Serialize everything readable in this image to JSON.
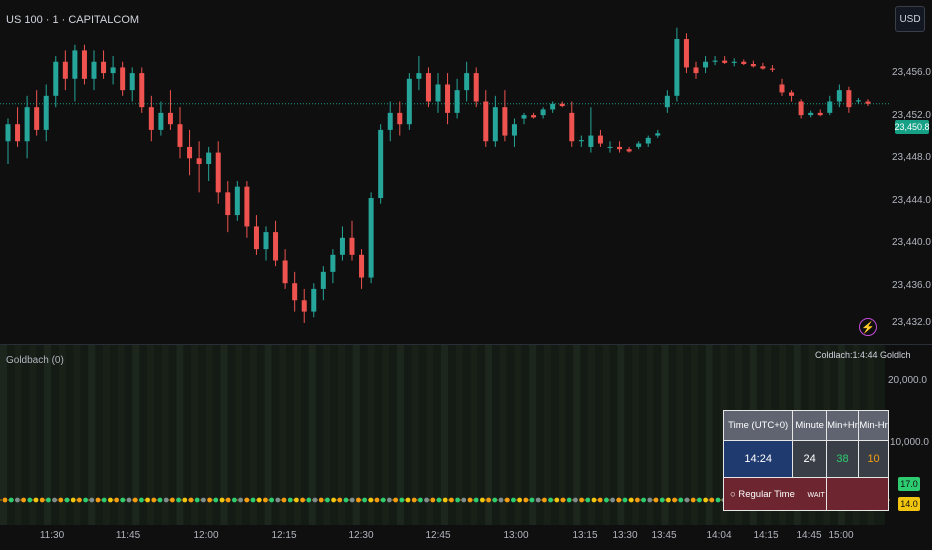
{
  "header": {
    "symbol": "US 100 · 1 · CAPITALCOM",
    "currency": "USD"
  },
  "price_axis": {
    "labels": [
      "23,456.0",
      "23,452.0",
      "23,448.0",
      "23,444.0",
      "23,440.0",
      "23,436.0",
      "23,432.0"
    ],
    "current_price": "23,450.8"
  },
  "indicator": {
    "title": "Goldbach (0)",
    "overlap_text": "Coldlach:1:4:44 Goldlch",
    "axis_labels": [
      "20,000.0",
      "10,000.0"
    ],
    "tag_green": "17.0",
    "tag_yellow": "14.0"
  },
  "time_axis": [
    "11:30",
    "11:45",
    "12:00",
    "12:15",
    "12:30",
    "12:45",
    "13:00",
    "13:15",
    "13:30",
    "13:45",
    "14:04",
    "14:15",
    "14:45",
    "15:00"
  ],
  "table": {
    "headers": [
      "Time (UTC+0)",
      "Minute",
      "Min+Hr",
      "Min-Hr"
    ],
    "time": "14:24",
    "minute": "24",
    "min_plus_hr": "38",
    "min_minus_hr": "10",
    "mode": "○ Regular Time",
    "signal": "WAIT"
  },
  "colors": {
    "up": "#26a69a",
    "down": "#ef5350",
    "background": "#0f0f0f",
    "price_line": "#16a085",
    "grid": "#1e222d"
  },
  "chart_data": {
    "type": "candlestick",
    "ylim": [
      23430,
      23458
    ],
    "candles": [
      {
        "o": 23447.5,
        "h": 23449.5,
        "l": 23445.5,
        "c": 23449.0
      },
      {
        "o": 23449.0,
        "h": 23450.5,
        "l": 23447.0,
        "c": 23447.5
      },
      {
        "o": 23447.5,
        "h": 23451.5,
        "l": 23446.0,
        "c": 23450.5
      },
      {
        "o": 23450.5,
        "h": 23452.0,
        "l": 23448.0,
        "c": 23448.5
      },
      {
        "o": 23448.5,
        "h": 23452.5,
        "l": 23447.5,
        "c": 23451.5
      },
      {
        "o": 23451.5,
        "h": 23455.0,
        "l": 23450.5,
        "c": 23454.5
      },
      {
        "o": 23454.5,
        "h": 23455.5,
        "l": 23452.0,
        "c": 23453.0
      },
      {
        "o": 23453.0,
        "h": 23456.0,
        "l": 23451.0,
        "c": 23455.5
      },
      {
        "o": 23455.5,
        "h": 23456.0,
        "l": 23452.5,
        "c": 23453.0
      },
      {
        "o": 23453.0,
        "h": 23455.5,
        "l": 23452.0,
        "c": 23454.5
      },
      {
        "o": 23454.5,
        "h": 23455.5,
        "l": 23453.0,
        "c": 23453.5
      },
      {
        "o": 23453.5,
        "h": 23455.0,
        "l": 23452.5,
        "c": 23454.0
      },
      {
        "o": 23454.0,
        "h": 23454.5,
        "l": 23451.5,
        "c": 23452.0
      },
      {
        "o": 23452.0,
        "h": 23454.0,
        "l": 23451.0,
        "c": 23453.5
      },
      {
        "o": 23453.5,
        "h": 23454.0,
        "l": 23450.0,
        "c": 23450.5
      },
      {
        "o": 23450.5,
        "h": 23451.5,
        "l": 23447.5,
        "c": 23448.5
      },
      {
        "o": 23448.5,
        "h": 23451.0,
        "l": 23448.0,
        "c": 23450.0
      },
      {
        "o": 23450.0,
        "h": 23452.0,
        "l": 23448.5,
        "c": 23449.0
      },
      {
        "o": 23449.0,
        "h": 23450.5,
        "l": 23446.0,
        "c": 23447.0
      },
      {
        "o": 23447.0,
        "h": 23448.5,
        "l": 23444.5,
        "c": 23446.0
      },
      {
        "o": 23446.0,
        "h": 23447.5,
        "l": 23443.0,
        "c": 23445.5
      },
      {
        "o": 23445.5,
        "h": 23447.0,
        "l": 23444.0,
        "c": 23446.5
      },
      {
        "o": 23446.5,
        "h": 23447.5,
        "l": 23442.0,
        "c": 23443.0
      },
      {
        "o": 23443.0,
        "h": 23444.0,
        "l": 23439.5,
        "c": 23441.0
      },
      {
        "o": 23441.0,
        "h": 23444.0,
        "l": 23440.5,
        "c": 23443.5
      },
      {
        "o": 23443.5,
        "h": 23444.0,
        "l": 23439.0,
        "c": 23440.0
      },
      {
        "o": 23440.0,
        "h": 23441.0,
        "l": 23437.5,
        "c": 23438.0
      },
      {
        "o": 23438.0,
        "h": 23440.0,
        "l": 23437.0,
        "c": 23439.5
      },
      {
        "o": 23439.5,
        "h": 23440.5,
        "l": 23436.5,
        "c": 23437.0
      },
      {
        "o": 23437.0,
        "h": 23438.0,
        "l": 23434.5,
        "c": 23435.0
      },
      {
        "o": 23435.0,
        "h": 23436.0,
        "l": 23432.5,
        "c": 23433.5
      },
      {
        "o": 23433.5,
        "h": 23434.5,
        "l": 23431.5,
        "c": 23432.5
      },
      {
        "o": 23432.5,
        "h": 23435.0,
        "l": 23432.0,
        "c": 23434.5
      },
      {
        "o": 23434.5,
        "h": 23436.5,
        "l": 23433.5,
        "c": 23436.0
      },
      {
        "o": 23436.0,
        "h": 23438.0,
        "l": 23435.0,
        "c": 23437.5
      },
      {
        "o": 23437.5,
        "h": 23440.0,
        "l": 23437.0,
        "c": 23439.0
      },
      {
        "o": 23439.0,
        "h": 23440.5,
        "l": 23437.0,
        "c": 23437.5
      },
      {
        "o": 23437.5,
        "h": 23438.0,
        "l": 23434.5,
        "c": 23435.5
      },
      {
        "o": 23435.5,
        "h": 23443.0,
        "l": 23435.0,
        "c": 23442.5
      },
      {
        "o": 23442.5,
        "h": 23449.0,
        "l": 23442.0,
        "c": 23448.5
      },
      {
        "o": 23448.5,
        "h": 23451.0,
        "l": 23447.5,
        "c": 23450.0
      },
      {
        "o": 23450.0,
        "h": 23451.0,
        "l": 23448.0,
        "c": 23449.0
      },
      {
        "o": 23449.0,
        "h": 23453.5,
        "l": 23448.5,
        "c": 23453.0
      },
      {
        "o": 23453.0,
        "h": 23455.0,
        "l": 23452.0,
        "c": 23453.5
      },
      {
        "o": 23453.5,
        "h": 23454.0,
        "l": 23450.5,
        "c": 23451.0
      },
      {
        "o": 23451.0,
        "h": 23453.5,
        "l": 23450.0,
        "c": 23452.5
      },
      {
        "o": 23452.5,
        "h": 23453.5,
        "l": 23449.0,
        "c": 23450.0
      },
      {
        "o": 23450.0,
        "h": 23453.0,
        "l": 23449.5,
        "c": 23452.0
      },
      {
        "o": 23452.0,
        "h": 23454.5,
        "l": 23451.0,
        "c": 23453.5
      },
      {
        "o": 23453.5,
        "h": 23454.0,
        "l": 23450.5,
        "c": 23451.0
      },
      {
        "o": 23451.0,
        "h": 23452.0,
        "l": 23447.0,
        "c": 23447.5
      },
      {
        "o": 23447.5,
        "h": 23451.5,
        "l": 23447.0,
        "c": 23450.5
      },
      {
        "o": 23450.5,
        "h": 23452.0,
        "l": 23447.5,
        "c": 23448.0
      },
      {
        "o": 23448.0,
        "h": 23449.5,
        "l": 23447.0,
        "c": 23449.0
      },
      {
        "o": 23449.5,
        "h": 23450.0,
        "l": 23449.0,
        "c": 23449.8
      },
      {
        "o": 23449.8,
        "h": 23450.0,
        "l": 23449.5,
        "c": 23449.6
      },
      {
        "o": 23449.8,
        "h": 23450.5,
        "l": 23449.5,
        "c": 23450.3
      },
      {
        "o": 23450.3,
        "h": 23451.0,
        "l": 23450.0,
        "c": 23450.8
      },
      {
        "o": 23450.8,
        "h": 23451.0,
        "l": 23450.5,
        "c": 23450.6
      },
      {
        "o": 23450.0,
        "h": 23451.0,
        "l": 23447.0,
        "c": 23447.5
      },
      {
        "o": 23447.5,
        "h": 23448.0,
        "l": 23447.0,
        "c": 23447.6
      },
      {
        "o": 23447.0,
        "h": 23450.5,
        "l": 23446.5,
        "c": 23448.0
      },
      {
        "o": 23448.0,
        "h": 23448.5,
        "l": 23447.0,
        "c": 23447.3
      },
      {
        "o": 23447.0,
        "h": 23447.5,
        "l": 23446.5,
        "c": 23447.0
      },
      {
        "o": 23447.0,
        "h": 23447.5,
        "l": 23446.5,
        "c": 23446.8
      },
      {
        "o": 23446.8,
        "h": 23447.0,
        "l": 23446.5,
        "c": 23446.6
      },
      {
        "o": 23447.0,
        "h": 23447.5,
        "l": 23446.8,
        "c": 23447.3
      },
      {
        "o": 23447.3,
        "h": 23448.0,
        "l": 23447.0,
        "c": 23447.8
      },
      {
        "o": 23448.0,
        "h": 23448.5,
        "l": 23447.8,
        "c": 23448.2
      },
      {
        "o": 23450.5,
        "h": 23452.0,
        "l": 23450.0,
        "c": 23451.5
      },
      {
        "o": 23451.5,
        "h": 23457.5,
        "l": 23451.0,
        "c": 23456.5
      },
      {
        "o": 23456.5,
        "h": 23457.0,
        "l": 23453.5,
        "c": 23454.0
      },
      {
        "o": 23454.0,
        "h": 23454.5,
        "l": 23453.0,
        "c": 23453.5
      },
      {
        "o": 23454.0,
        "h": 23455.0,
        "l": 23453.5,
        "c": 23454.5
      },
      {
        "o": 23454.5,
        "h": 23455.0,
        "l": 23454.2,
        "c": 23454.6
      },
      {
        "o": 23454.6,
        "h": 23455.0,
        "l": 23454.3,
        "c": 23454.4
      },
      {
        "o": 23454.4,
        "h": 23454.8,
        "l": 23454.1,
        "c": 23454.5
      },
      {
        "o": 23454.5,
        "h": 23454.7,
        "l": 23454.2,
        "c": 23454.3
      },
      {
        "o": 23454.3,
        "h": 23454.6,
        "l": 23454.0,
        "c": 23454.1
      },
      {
        "o": 23454.1,
        "h": 23454.4,
        "l": 23453.8,
        "c": 23453.9
      },
      {
        "o": 23453.9,
        "h": 23454.2,
        "l": 23453.6,
        "c": 23453.8
      },
      {
        "o": 23452.5,
        "h": 23453.0,
        "l": 23451.5,
        "c": 23451.8
      },
      {
        "o": 23451.8,
        "h": 23452.0,
        "l": 23451.0,
        "c": 23451.5
      },
      {
        "o": 23451.0,
        "h": 23451.2,
        "l": 23449.5,
        "c": 23449.8
      },
      {
        "o": 23449.8,
        "h": 23450.2,
        "l": 23449.6,
        "c": 23450.0
      },
      {
        "o": 23450.0,
        "h": 23450.3,
        "l": 23449.7,
        "c": 23449.8
      },
      {
        "o": 23450.0,
        "h": 23451.5,
        "l": 23449.8,
        "c": 23451.0
      },
      {
        "o": 23451.0,
        "h": 23452.5,
        "l": 23450.5,
        "c": 23452.0
      },
      {
        "o": 23452.0,
        "h": 23452.3,
        "l": 23450.0,
        "c": 23450.5
      },
      {
        "o": 23451.0,
        "h": 23451.3,
        "l": 23450.8,
        "c": 23451.1
      },
      {
        "o": 23451.0,
        "h": 23451.2,
        "l": 23450.6,
        "c": 23450.8
      }
    ]
  }
}
